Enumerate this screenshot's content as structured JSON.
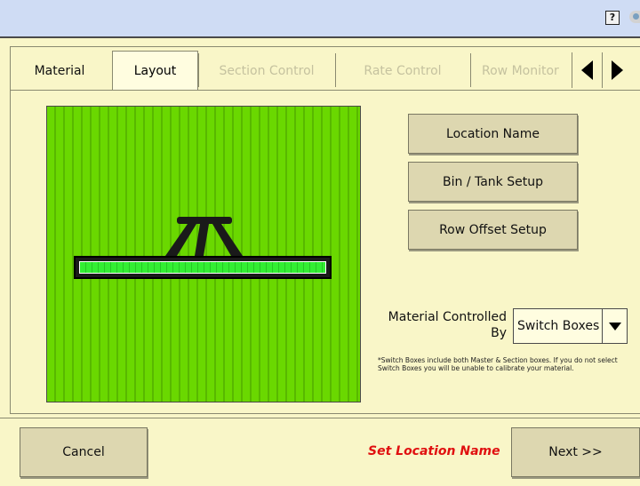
{
  "toolbar": {
    "help_label": "?"
  },
  "tabs": [
    {
      "label": "Material",
      "state": "enabled"
    },
    {
      "label": "Layout",
      "state": "active"
    },
    {
      "label": "Section Control",
      "state": "disabled"
    },
    {
      "label": "Rate Control",
      "state": "disabled"
    },
    {
      "label": "Row Monitor",
      "state": "disabled"
    }
  ],
  "buttons": {
    "location_name": "Location Name",
    "bin_tank_setup": "Bin / Tank Setup",
    "row_offset_setup": "Row Offset Setup"
  },
  "material_control": {
    "label_line1": "Material Controlled",
    "label_line2": "By",
    "selected": "Switch Boxes",
    "note": "*Switch Boxes include both Master & Section boxes.  If you do not select Switch Boxes you will be unable to calibrate your material."
  },
  "footer": {
    "cancel": "Cancel",
    "status": "Set Location Name",
    "next": "Next >>"
  },
  "colors": {
    "background": "#f9f6c8",
    "field_green": "#6ad800",
    "boom_green": "#33ee33",
    "status_red": "#e01010",
    "button": "#ddd7b0",
    "topbar": "#cfdcf4"
  }
}
